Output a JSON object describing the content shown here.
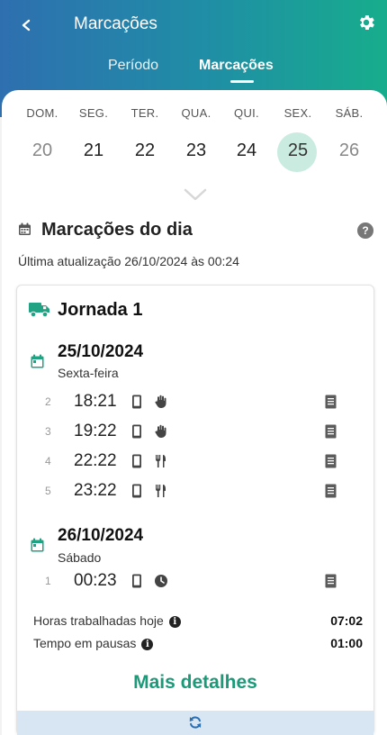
{
  "header": {
    "title": "Marcações",
    "back_icon": "chevron-left-icon",
    "settings_icon": "gear-icon",
    "tabs": [
      {
        "label": "Período",
        "active": false
      },
      {
        "label": "Marcações",
        "active": true
      }
    ],
    "gradient_colors": [
      "#2e6fb0",
      "#1f8fa5",
      "#17ad8c"
    ]
  },
  "week": {
    "days": [
      {
        "name": "DOM.",
        "number": "20",
        "muted": true
      },
      {
        "name": "SEG.",
        "number": "21",
        "muted": false
      },
      {
        "name": "TER.",
        "number": "22",
        "muted": false
      },
      {
        "name": "QUA.",
        "number": "23",
        "muted": false
      },
      {
        "name": "QUI.",
        "number": "24",
        "muted": false
      },
      {
        "name": "SEX.",
        "number": "25",
        "selected": true
      },
      {
        "name": "SÁB.",
        "number": "26",
        "muted": true
      }
    ],
    "selected_color": "#c9ebe0",
    "expand_icon": "chevron-down-icon"
  },
  "section": {
    "icon": "calendar-icon",
    "title": "Marcações do dia",
    "help_icon": "question-icon",
    "help_label": "?",
    "last_update": "Última atualização 26/10/2024 às 00:24"
  },
  "jornada": {
    "icon": "truck-icon",
    "title": "Jornada 1",
    "groups": [
      {
        "date": "25/10/2024",
        "weekday": "Sexta-feira",
        "entries": [
          {
            "index": "2",
            "time": "18:21",
            "device_icon": "phone-icon",
            "type_icon": "hand-icon",
            "doc_icon": "document-icon"
          },
          {
            "index": "3",
            "time": "19:22",
            "device_icon": "phone-icon",
            "type_icon": "hand-icon",
            "doc_icon": "document-icon"
          },
          {
            "index": "4",
            "time": "22:22",
            "device_icon": "phone-icon",
            "type_icon": "utensils-icon",
            "doc_icon": "document-icon"
          },
          {
            "index": "5",
            "time": "23:22",
            "device_icon": "phone-icon",
            "type_icon": "utensils-icon",
            "doc_icon": "document-icon"
          }
        ]
      },
      {
        "date": "26/10/2024",
        "weekday": "Sábado",
        "entries": [
          {
            "index": "1",
            "time": "00:23",
            "device_icon": "phone-icon",
            "type_icon": "clock-icon",
            "doc_icon": "document-icon"
          }
        ]
      }
    ],
    "stats": [
      {
        "label": "Horas trabalhadas hoje",
        "value": "07:02",
        "info_icon": "info-icon"
      },
      {
        "label": "Tempo em pausas",
        "value": "01:00",
        "info_icon": "info-icon"
      }
    ],
    "info_glyph": "i",
    "accent_color": "#1a9a78",
    "more_label": "Mais detalhes",
    "refresh_icon": "refresh-icon"
  }
}
